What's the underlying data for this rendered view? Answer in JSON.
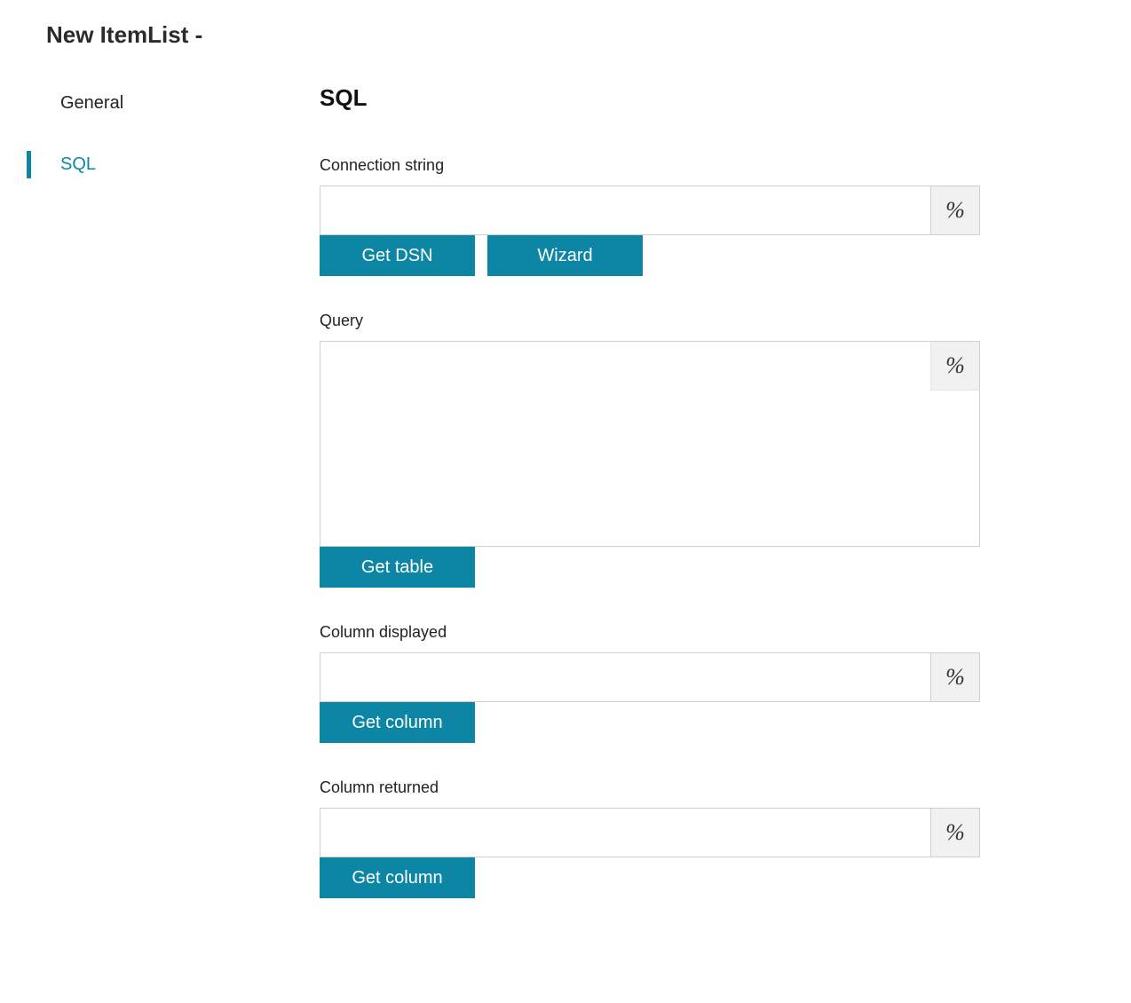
{
  "header": {
    "title": "New ItemList -"
  },
  "sidebar": {
    "items": [
      {
        "label": "General",
        "active": false
      },
      {
        "label": "SQL",
        "active": true
      }
    ]
  },
  "main": {
    "section_title": "SQL",
    "connection_string": {
      "label": "Connection string",
      "value": "",
      "buttons": {
        "get_dsn": "Get DSN",
        "wizard": "Wizard"
      }
    },
    "query": {
      "label": "Query",
      "value": "",
      "buttons": {
        "get_table": "Get table"
      }
    },
    "column_displayed": {
      "label": "Column displayed",
      "value": "",
      "buttons": {
        "get_column": "Get column"
      }
    },
    "column_returned": {
      "label": "Column returned",
      "value": "",
      "buttons": {
        "get_column": "Get column"
      }
    },
    "percent_label": "%"
  }
}
